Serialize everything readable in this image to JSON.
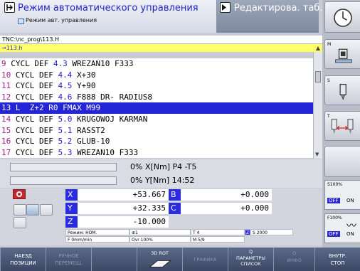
{
  "header": {
    "mode_title": "Режим автоматического управления",
    "mode_subtitle": "Режим авт. управления",
    "edit_title": "Редактирова. таб…"
  },
  "program": {
    "path": "TNC:\\nc_prog\\113.H",
    "file": "→113.h",
    "lines": [
      {
        "num": "9",
        "cmd": "CYCL DEF",
        "cyc": "4.3",
        "rest": "WREZAN10 F333"
      },
      {
        "num": "10",
        "cmd": "CYCL DEF",
        "cyc": "4.4",
        "rest": "X+30"
      },
      {
        "num": "11",
        "cmd": "CYCL DEF",
        "cyc": "4.5",
        "rest": "Y+90"
      },
      {
        "num": "12",
        "cmd": "CYCL DEF",
        "cyc": "4.6",
        "rest": "F888 DR- RADIUS8"
      },
      {
        "num": "13",
        "cmd": "L  Z+2 R0 FMAX M99",
        "cyc": "",
        "rest": ""
      },
      {
        "num": "14",
        "cmd": "CYCL DEF",
        "cyc": "5.0",
        "rest": "KRUGOWOJ KARMAN"
      },
      {
        "num": "15",
        "cmd": "CYCL DEF",
        "cyc": "5.1",
        "rest": "RASST2"
      },
      {
        "num": "16",
        "cmd": "CYCL DEF",
        "cyc": "5.2",
        "rest": "GLUB-10"
      },
      {
        "num": "17",
        "cmd": "CYCL DEF",
        "cyc": "5.3",
        "rest": "WREZAN10 F333"
      }
    ],
    "active_line_index": 4
  },
  "status": {
    "row1": {
      "pct": "0%",
      "axis": "X[Nm]",
      "extra": "P4   -T5",
      "fill": 0
    },
    "row2": {
      "pct": "0%",
      "axis": "Y[Nm]",
      "extra": "14:52",
      "fill": 0
    }
  },
  "positions": {
    "X": "+53.667",
    "Y": "+32.335",
    "Z": "-10.000",
    "B": "+0.000",
    "C": "+0.000",
    "labels": {
      "X": "X",
      "Y": "Y",
      "Z": "Z",
      "B": "B",
      "C": "C"
    }
  },
  "info": {
    "mode": "Режим: НОМ.",
    "zero": "1",
    "tool": "T 4",
    "spindle": "S 2000",
    "feed": "F 0mm/min",
    "ovr": "Ovr 100%",
    "mfunc": "M 5/9",
    "z_flag": "Z"
  },
  "sidebar": {
    "m_label": "M",
    "s_label": "S",
    "t_label": "T",
    "s_override": "S100%",
    "f_override": "F100%",
    "off": "OFF",
    "on": "ON"
  },
  "softkeys": [
    {
      "t1": "НАЕЗД",
      "t2": "ПОЗИЦИИ",
      "dim": false
    },
    {
      "t1": "РУЧНОЕ",
      "t2": "ПЕРЕМЕЩ.",
      "dim": true
    },
    {
      "t1": "3D ROT",
      "t2": "",
      "dim": false
    },
    {
      "t1": "",
      "t2": "ГРАФИКА",
      "dim": true
    },
    {
      "t1": "Q",
      "t2": "ПАРАМЕТРЫ СПИСОК",
      "dim": false
    },
    {
      "t1": "Q",
      "t2": "ИНФО",
      "dim": true
    },
    {
      "t1": "ВНУТР.",
      "t2": "СТОП",
      "dim": false
    }
  ],
  "colors": {
    "header_bg": "#3c4a66",
    "accent_blue": "#2525d8",
    "nc_number": "#a0208a",
    "file_bar": "#ffff66"
  }
}
